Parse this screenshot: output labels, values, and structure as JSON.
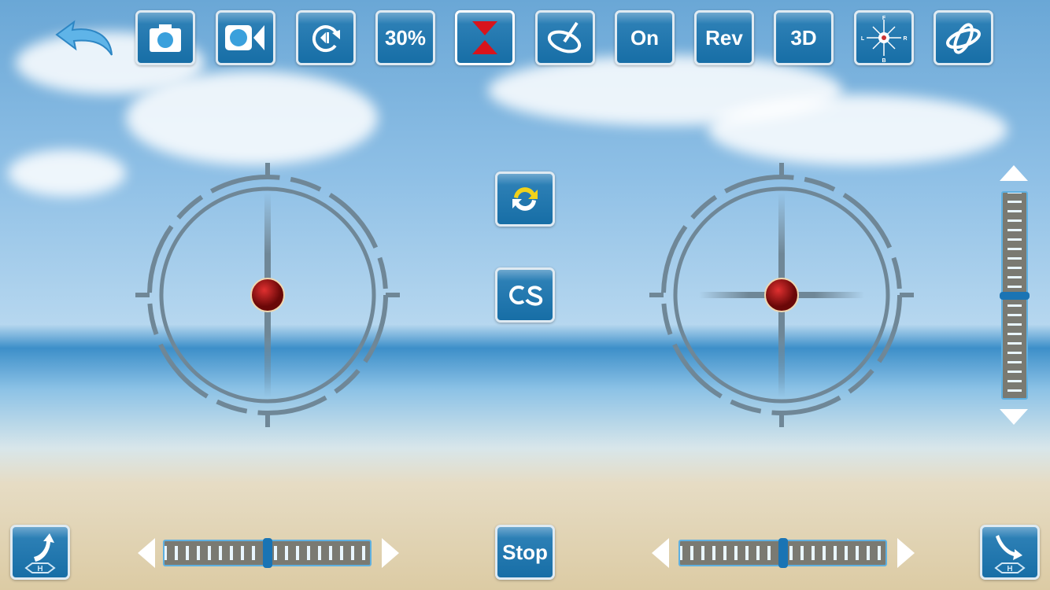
{
  "toolbar": {
    "back_icon": "back-arrow-icon",
    "buttons": [
      {
        "name": "photo",
        "icon": "camera-icon"
      },
      {
        "name": "video",
        "icon": "video-camera-icon"
      },
      {
        "name": "rotate",
        "icon": "rotate-icon"
      },
      {
        "name": "speed",
        "label": "30%"
      },
      {
        "name": "altitude-hold",
        "icon": "hourglass-arrows-icon"
      },
      {
        "name": "gyro-calibrate",
        "icon": "gyro-icon"
      },
      {
        "name": "power",
        "label": "On"
      },
      {
        "name": "reverse",
        "label": "Rev"
      },
      {
        "name": "3d-flip",
        "label": "3D"
      },
      {
        "name": "headless",
        "icon": "compass-icon",
        "compass_labels": {
          "f": "F",
          "b": "B",
          "l": "L",
          "r": "R"
        }
      },
      {
        "name": "orbit",
        "icon": "orbit-icon"
      }
    ]
  },
  "center": {
    "swap_icon": "swap-arrows-icon",
    "cs_label": "CS",
    "stop_label": "Stop"
  },
  "trims": {
    "left_horizontal": 0.5,
    "right_horizontal": 0.5,
    "vertical": 0.5
  },
  "colors": {
    "button": "#176ea6",
    "ring": "#6f8797",
    "ball": "#b01010"
  }
}
